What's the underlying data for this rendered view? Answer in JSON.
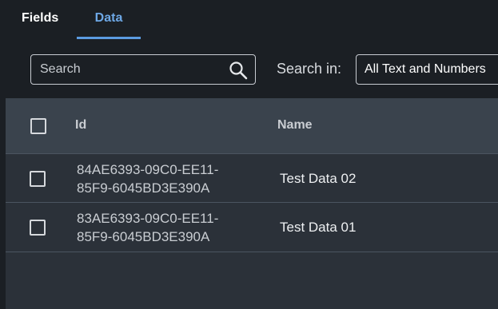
{
  "tabs": [
    {
      "label": "Fields",
      "active": false
    },
    {
      "label": "Data",
      "active": true
    }
  ],
  "search": {
    "placeholder": "Search",
    "value": "",
    "icon": "search-icon"
  },
  "search_in": {
    "label": "Search in:",
    "selected": "All Text and Numbers"
  },
  "table": {
    "columns": [
      "Id",
      "Name"
    ],
    "rows": [
      {
        "id_line1": "84AE6393-09C0-EE11-",
        "id_line2": "85F9-6045BD3E390A",
        "name": "Test Data 02",
        "checked": false
      },
      {
        "id_line1": "83AE6393-09C0-EE11-",
        "id_line2": "85F9-6045BD3E390A",
        "name": "Test Data 01",
        "checked": false
      }
    ]
  },
  "colors": {
    "background": "#1b1f24",
    "accent": "#5b9be0",
    "header_bg": "#3a434d",
    "row_bg": "#2b3139"
  }
}
